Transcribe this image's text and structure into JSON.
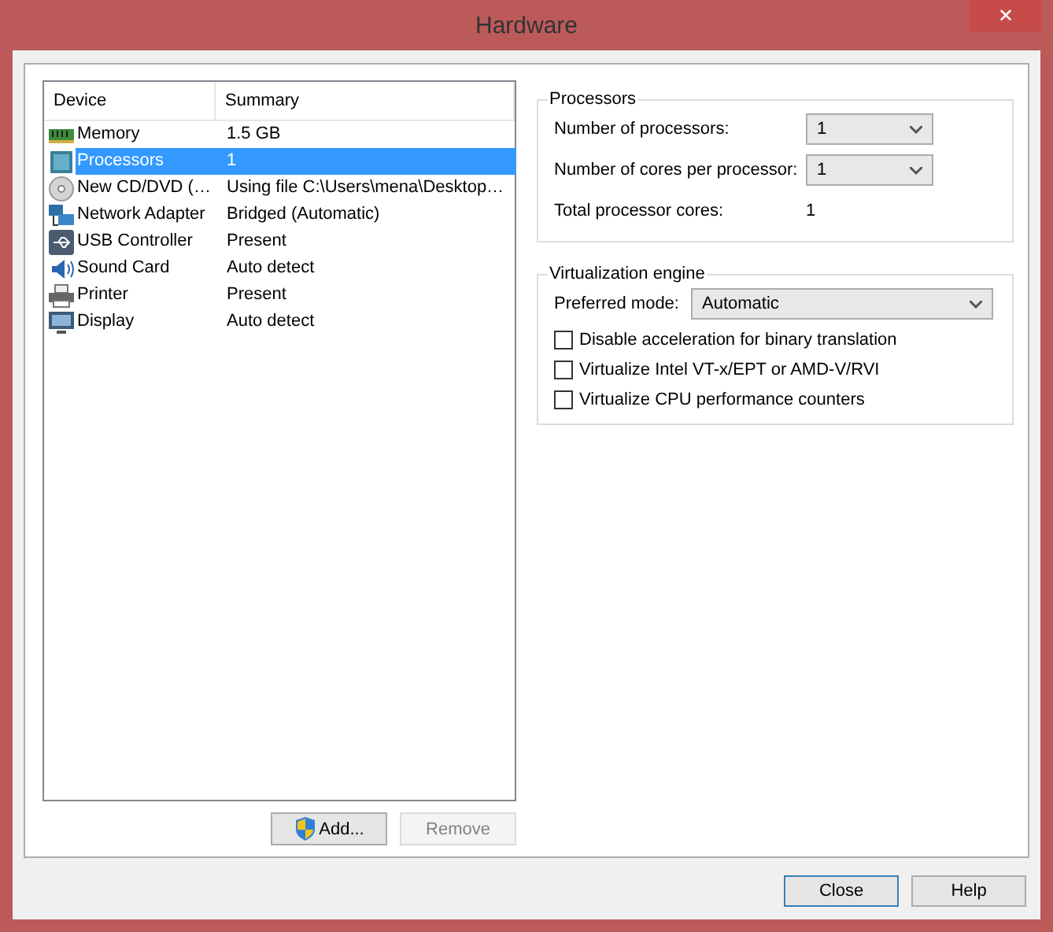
{
  "window": {
    "title": "Hardware",
    "close": "✕"
  },
  "devices": {
    "columns": [
      "Device",
      "Summary"
    ],
    "rows": [
      {
        "kind": "memory",
        "device": "Memory",
        "summary": "1.5 GB",
        "selected": false
      },
      {
        "kind": "processor",
        "device": "Processors",
        "summary": "1",
        "selected": true
      },
      {
        "kind": "cdrom",
        "device": "New CD/DVD (…",
        "summary": "Using file C:\\Users\\mena\\Desktop…",
        "selected": false
      },
      {
        "kind": "network",
        "device": "Network Adapter",
        "summary": "Bridged (Automatic)",
        "selected": false
      },
      {
        "kind": "usb",
        "device": "USB Controller",
        "summary": "Present",
        "selected": false
      },
      {
        "kind": "sound",
        "device": "Sound Card",
        "summary": "Auto detect",
        "selected": false
      },
      {
        "kind": "printer",
        "device": "Printer",
        "summary": "Present",
        "selected": false
      },
      {
        "kind": "display",
        "device": "Display",
        "summary": "Auto detect",
        "selected": false
      }
    ],
    "buttons": [
      {
        "label": "Add...",
        "disabled": false,
        "shield": true
      },
      {
        "label": "Remove",
        "disabled": true,
        "shield": false
      }
    ]
  },
  "processors": {
    "title": "Processors",
    "number_of_processors": {
      "label": "Number of processors:",
      "value": "1"
    },
    "cores_per_processor": {
      "label": "Number of cores per processor:",
      "value": "1"
    },
    "total_cores": {
      "label": "Total processor cores:",
      "value": "1"
    }
  },
  "virtualization": {
    "title": "Virtualization engine",
    "preferred_mode": {
      "label": "Preferred mode:",
      "value": "Automatic"
    },
    "options": [
      {
        "label": "Disable acceleration for binary translation",
        "checked": false
      },
      {
        "label": "Virtualize Intel VT-x/EPT or AMD-V/RVI",
        "checked": false
      },
      {
        "label": "Virtualize CPU performance counters",
        "checked": false
      }
    ]
  },
  "footer": [
    {
      "label": "Close",
      "default": true
    },
    {
      "label": "Help",
      "default": false
    }
  ]
}
